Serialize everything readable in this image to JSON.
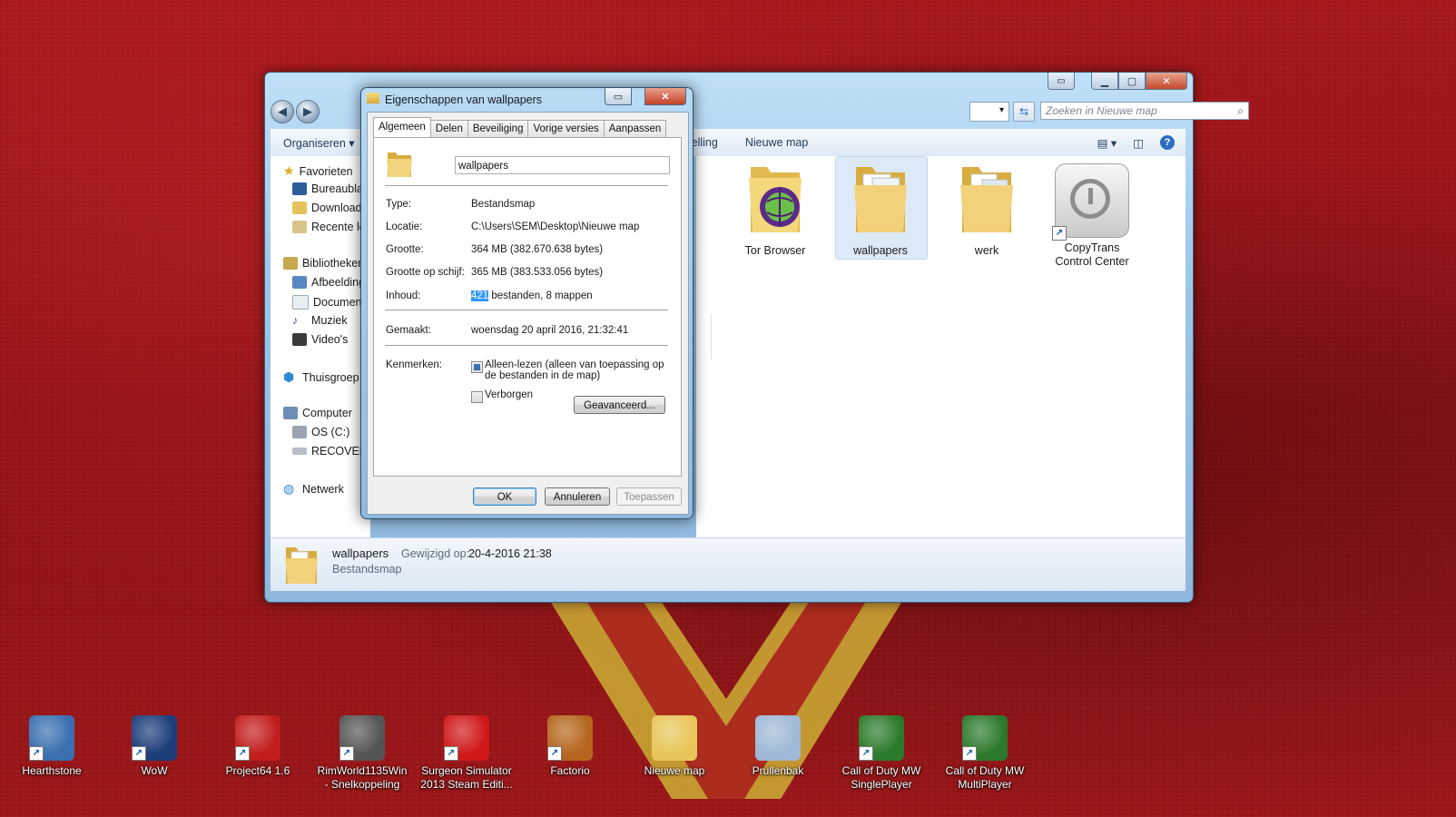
{
  "explorer": {
    "search_placeholder": "Zoeken in Nieuwe map",
    "toolbar": {
      "organize": "Organiseren ▾",
      "slideshow": "Diavoorstelling",
      "new_folder": "Nieuwe map"
    },
    "nav": {
      "favorites": "Favorieten",
      "desktop": "Bureaublad",
      "downloads": "Downloads",
      "recent": "Recente locaties",
      "libraries": "Bibliotheken",
      "pictures": "Afbeeldingen",
      "documents": "Documenten",
      "music": "Muziek",
      "videos": "Video's",
      "homegroup": "Thuisgroep",
      "computer": "Computer",
      "os_drive": "OS (C:)",
      "recovery": "RECOVERY",
      "network": "Netwerk"
    },
    "items": [
      {
        "name": "Tor Browser"
      },
      {
        "name": "wallpapers"
      },
      {
        "name": "werk"
      },
      {
        "name": "CopyTrans Control Center"
      }
    ],
    "details": {
      "name": "wallpapers",
      "modified_label": "Gewijzigd op:",
      "modified_value": "20-4-2016 21:38",
      "type": "Bestandsmap"
    }
  },
  "dialog": {
    "title": "Eigenschappen van wallpapers",
    "tabs": [
      "Algemeen",
      "Delen",
      "Beveiliging",
      "Vorige versies",
      "Aanpassen"
    ],
    "folder_name": "wallpapers",
    "rows": {
      "type_label": "Type:",
      "type_value": "Bestandsmap",
      "location_label": "Locatie:",
      "location_value": "C:\\Users\\SEM\\Desktop\\Nieuwe map",
      "size_label": "Grootte:",
      "size_value": "364 MB (382.670.638 bytes)",
      "disk_size_label": "Grootte op schijf:",
      "disk_size_value": "365 MB (383.533.056 bytes)",
      "contents_label": "Inhoud:",
      "contents_selected": "421",
      "contents_rest": " bestanden, 8 mappen",
      "created_label": "Gemaakt:",
      "created_value": "woensdag 20 april 2016, 21:32:41",
      "attributes_label": "Kenmerken:",
      "readonly_label": "Alleen-lezen (alleen van toepassing op de bestanden in de map)",
      "hidden_label": "Verborgen",
      "advanced_button": "Geavanceerd..."
    },
    "buttons": {
      "ok": "OK",
      "cancel": "Annuleren",
      "apply": "Toepassen"
    }
  },
  "desktop_icons": [
    {
      "label": "Hearthstone",
      "color": "#3a6fb0"
    },
    {
      "label": "WoW",
      "color": "#1c3d7a"
    },
    {
      "label": "Project64 1.6",
      "color": "#c21d1d"
    },
    {
      "label": "RimWorld1135Win - Snelkoppeling",
      "color": "#555555"
    },
    {
      "label": "Surgeon Simulator 2013 Steam Editi...",
      "color": "#d01818"
    },
    {
      "label": "Factorio",
      "color": "#b5651d"
    },
    {
      "label": "Nieuwe map",
      "color": "#e8c65a"
    },
    {
      "label": "Prullenbak",
      "color": "#9fb8d6"
    },
    {
      "label": "Call of Duty MW SinglePlayer",
      "color": "#2b7a2b"
    },
    {
      "label": "Call of Duty MW MultiPlayer",
      "color": "#2b7a2b"
    }
  ]
}
